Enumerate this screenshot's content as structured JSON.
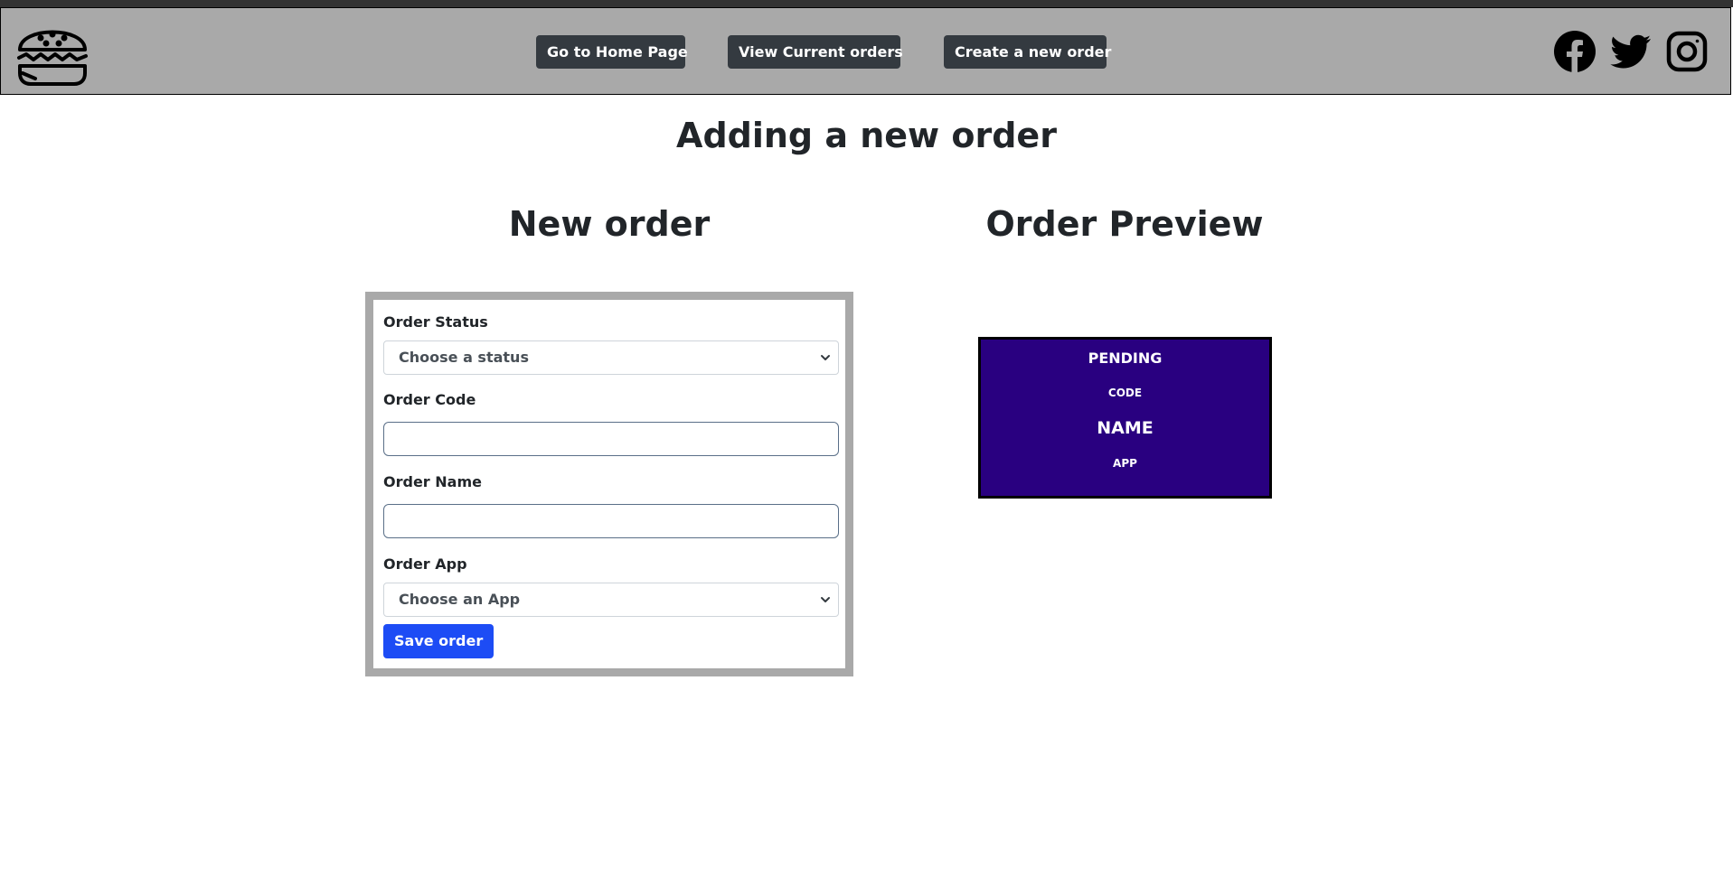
{
  "navbar": {
    "logo_icon": "burger-icon",
    "buttons": [
      {
        "label": "Go to Home Page"
      },
      {
        "label": "View Current orders"
      },
      {
        "label": "Create a new order"
      }
    ],
    "social": [
      {
        "icon": "facebook-icon"
      },
      {
        "icon": "twitter-icon"
      },
      {
        "icon": "instagram-icon"
      }
    ]
  },
  "page": {
    "title": "Adding a new order"
  },
  "form": {
    "title": "New order",
    "status_label": "Order Status",
    "status_value": "Choose a status",
    "code_label": "Order Code",
    "code_value": "",
    "name_label": "Order Name",
    "name_value": "",
    "app_label": "Order App",
    "app_value": "Choose an App",
    "save_label": "Save order"
  },
  "preview": {
    "title": "Order Preview",
    "status": "PENDING",
    "code": "CODE",
    "name": "NAME",
    "app": "APP"
  },
  "colors": {
    "navbar_bg": "#a9a9a9",
    "nav_button": "#343a40",
    "save_button": "#1d4cf5",
    "preview_bg": "#290080",
    "form_border": "#a9a9a9"
  }
}
